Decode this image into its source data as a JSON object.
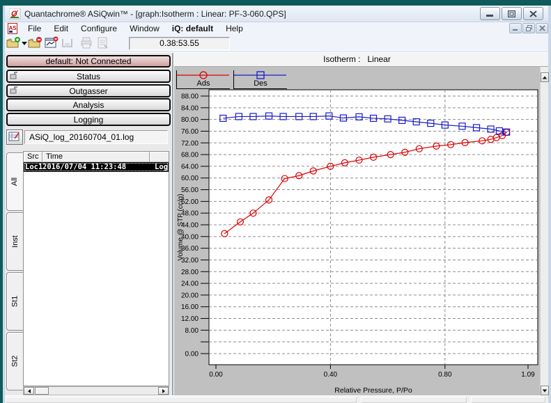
{
  "window": {
    "title": "Quantachrome® ASiQwin™ - [graph:Isotherm :  Linear: PF-3-060.QPS]"
  },
  "menu": {
    "as_icon_text": "AS",
    "items": [
      {
        "label": "File",
        "bold": false
      },
      {
        "label": "Edit",
        "bold": false
      },
      {
        "label": "Configure",
        "bold": false
      },
      {
        "label": "Window",
        "bold": false
      },
      {
        "label": "iQ: default",
        "bold": true
      },
      {
        "label": "Help",
        "bold": false
      }
    ]
  },
  "toolbar": {
    "elapsed_time": "0.38:53.55",
    "buttons": [
      {
        "name": "open-file",
        "enabled": true
      },
      {
        "name": "open-data-file",
        "enabled": true
      },
      {
        "name": "show-graph",
        "enabled": true
      },
      {
        "name": "save",
        "enabled": false
      },
      {
        "name": "print",
        "enabled": false
      },
      {
        "name": "print-preview",
        "enabled": false
      }
    ]
  },
  "sidebar": {
    "connection_button": {
      "label": "default: Not Connected"
    },
    "buttons": [
      {
        "label": "Status",
        "icon": "instrument-icon"
      },
      {
        "label": "Outgasser",
        "icon": "instrument-icon"
      },
      {
        "label": "Analysis",
        "icon": null
      },
      {
        "label": "Logging",
        "icon": null
      }
    ],
    "log_file": {
      "value": "ASiQ_log_20160704_01.log"
    },
    "tabs": [
      {
        "label": "All",
        "selected": true
      },
      {
        "label": "Inst",
        "selected": false
      },
      {
        "label": "St1",
        "selected": false
      },
      {
        "label": "St2",
        "selected": false
      }
    ],
    "log_table": {
      "columns": [
        "Src",
        "Time"
      ],
      "rows": [
        {
          "src": "Loc1",
          "time": "2016/07/04 11:23:48",
          "message": "Log",
          "selected": true
        }
      ]
    }
  },
  "graph": {
    "header": "Isotherm :   Linear"
  },
  "chart_data": {
    "type": "line",
    "title": "Isotherm : Linear",
    "xlabel": "Relative Pressure, P/Po",
    "ylabel": "Volume @ STP (cc/g)",
    "xlim": [
      0,
      1.09
    ],
    "ylim": [
      0,
      88
    ],
    "x_ticks": [
      0.0,
      0.4,
      0.8,
      1.09
    ],
    "x_tick_labels": [
      "0.00",
      "0.40",
      "0.80",
      "1.09"
    ],
    "x_gridlines": [
      0.4,
      0.8
    ],
    "y_tick_step": 4,
    "y_hidden_tick_labels": [
      4
    ],
    "grid": true,
    "legend_position": "top-left",
    "series": [
      {
        "name": "Ads",
        "color": "#dd0000",
        "marker": "circle",
        "x": [
          0.03,
          0.085,
          0.13,
          0.185,
          0.24,
          0.29,
          0.34,
          0.4,
          0.45,
          0.5,
          0.55,
          0.61,
          0.66,
          0.71,
          0.77,
          0.82,
          0.87,
          0.93,
          0.96,
          0.98,
          1.0,
          1.015
        ],
        "y": [
          41.0,
          45.0,
          48.0,
          52.5,
          59.8,
          60.8,
          62.4,
          64.0,
          65.2,
          66.1,
          67.1,
          68.0,
          68.8,
          70.0,
          70.9,
          71.4,
          72.1,
          72.7,
          73.2,
          73.8,
          74.5,
          75.6
        ]
      },
      {
        "name": "Des",
        "color": "#1a1acc",
        "marker": "square",
        "x": [
          0.025,
          0.08,
          0.13,
          0.185,
          0.235,
          0.29,
          0.34,
          0.395,
          0.445,
          0.5,
          0.55,
          0.6,
          0.65,
          0.7,
          0.75,
          0.8,
          0.86,
          0.91,
          0.96,
          0.99,
          1.015
        ],
        "y": [
          80.4,
          81.0,
          81.0,
          81.2,
          81.0,
          81.0,
          81.0,
          81.2,
          80.5,
          80.9,
          80.4,
          80.2,
          79.7,
          79.2,
          78.7,
          78.1,
          77.7,
          77.2,
          76.7,
          76.1,
          75.7
        ]
      }
    ]
  },
  "colors": {
    "frame_teal": "#0f5b5b",
    "graph_bg": "#c0c0c0",
    "connection_status_pink": "#cfa1a1",
    "ads_red": "#dd0000",
    "des_blue": "#1a1acc"
  }
}
